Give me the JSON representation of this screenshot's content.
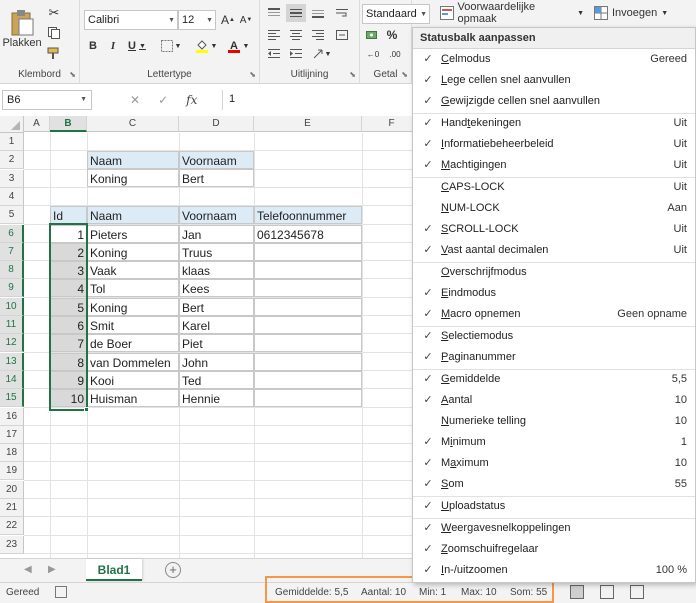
{
  "ribbon": {
    "clipboard": {
      "paste_label": "Plakken",
      "group_label": "Klembord"
    },
    "font": {
      "name": "Calibri",
      "size": "12",
      "bold": "B",
      "italic": "I",
      "underline": "U",
      "grow": "A",
      "shrink": "A",
      "group_label": "Lettertype"
    },
    "alignment": {
      "group_label": "Uitlijning"
    },
    "number": {
      "format": "Standaard",
      "percent": "%",
      "group_label": "Getal"
    },
    "styles": {
      "conditional_label": "Voorwaardelijke opmaak"
    },
    "cells": {
      "insert_label": "Invoegen"
    }
  },
  "formula_bar": {
    "name_box": "B6",
    "fx": "fx",
    "value": "1"
  },
  "columns": [
    "A",
    "B",
    "C",
    "D",
    "E",
    "F"
  ],
  "rows": [
    "1",
    "2",
    "3",
    "4",
    "5",
    "6",
    "7",
    "8",
    "9",
    "10",
    "11",
    "12",
    "13",
    "14",
    "15",
    "16",
    "17",
    "18",
    "19",
    "20",
    "21",
    "22",
    "23"
  ],
  "table1": {
    "headers": [
      "Naam",
      "Voornaam"
    ],
    "rows": [
      [
        "Koning",
        "Bert"
      ]
    ]
  },
  "table2": {
    "headers": [
      "Id",
      "Naam",
      "Voornaam",
      "Telefoonnummer"
    ],
    "rows": [
      [
        "1",
        "Pieters",
        "Jan",
        "0612345678"
      ],
      [
        "2",
        "Koning",
        "Truus",
        ""
      ],
      [
        "3",
        "Vaak",
        "klaas",
        ""
      ],
      [
        "4",
        "Tol",
        "Kees",
        ""
      ],
      [
        "5",
        "Koning",
        "Bert",
        ""
      ],
      [
        "6",
        "Smit",
        "Karel",
        ""
      ],
      [
        "7",
        "de Boer",
        "Piet",
        ""
      ],
      [
        "8",
        "van Dommelen",
        "John",
        ""
      ],
      [
        "9",
        "Kooi",
        "Ted",
        ""
      ],
      [
        "10",
        "Huisman",
        "Hennie",
        ""
      ]
    ]
  },
  "sheet_tabs": {
    "active": "Blad1",
    "add": "+"
  },
  "status_bar": {
    "mode": "Gereed",
    "average": "Gemiddelde: 5,5",
    "count": "Aantal: 10",
    "min": "Min: 1",
    "max": "Max: 10",
    "sum": "Som: 55"
  },
  "context_menu": {
    "title": "Statusbalk aanpassen",
    "items": [
      {
        "ak": "C",
        "rest": "elmodus",
        "value": "Gereed",
        "checked": true
      },
      {
        "ak": "L",
        "rest": "ege cellen snel aanvullen",
        "value": "",
        "checked": true
      },
      {
        "ak": "G",
        "rest": "ewijzigde cellen snel aanvullen",
        "value": "",
        "checked": true
      },
      {
        "pre": "Hand",
        "ak": "t",
        "rest": "ekeningen",
        "value": "Uit",
        "checked": true
      },
      {
        "ak": "I",
        "rest": "nformatiebeheerbeleid",
        "value": "Uit",
        "checked": true
      },
      {
        "ak": "M",
        "rest": "achtigingen",
        "value": "Uit",
        "checked": true
      },
      {
        "ak": "C",
        "rest": "APS-LOCK",
        "value": "Uit",
        "checked": false
      },
      {
        "ak": "N",
        "rest": "UM-LOCK",
        "value": "Aan",
        "checked": false
      },
      {
        "ak": "S",
        "rest": "CROLL-LOCK",
        "value": "Uit",
        "checked": true
      },
      {
        "ak": "V",
        "rest": "ast aantal decimalen",
        "value": "Uit",
        "checked": true
      },
      {
        "ak": "O",
        "rest": "verschrijfmodus",
        "value": "",
        "checked": false
      },
      {
        "ak": "E",
        "rest": "indmodus",
        "value": "",
        "checked": true
      },
      {
        "ak": "M",
        "rest": "acro opnemen",
        "value": "Geen opname",
        "checked": true
      },
      {
        "ak": "S",
        "rest": "electiemodus",
        "value": "",
        "checked": true
      },
      {
        "ak": "P",
        "rest": "aginanummer",
        "value": "",
        "checked": true
      },
      {
        "ak": "G",
        "rest": "emiddelde",
        "value": "5,5",
        "checked": true
      },
      {
        "ak": "A",
        "rest": "antal",
        "value": "10",
        "checked": true
      },
      {
        "ak": "N",
        "rest": "umerieke telling",
        "value": "10",
        "checked": false
      },
      {
        "pre": "M",
        "ak": "i",
        "rest": "nimum",
        "value": "1",
        "checked": true
      },
      {
        "pre": "M",
        "ak": "a",
        "rest": "ximum",
        "value": "10",
        "checked": true
      },
      {
        "ak": "S",
        "rest": "om",
        "value": "55",
        "checked": true
      },
      {
        "ak": "U",
        "rest": "ploadstatus",
        "value": "",
        "checked": true
      },
      {
        "ak": "W",
        "rest": "eergavesnelkoppelingen",
        "value": "",
        "checked": true
      },
      {
        "ak": "Z",
        "rest": "oomschuifregelaar",
        "value": "",
        "checked": true
      },
      {
        "ak": "I",
        "rest": "n-/uitzoomen",
        "value": "100 %",
        "checked": true
      }
    ]
  },
  "colors": {
    "excel_green": "#217346",
    "header_blue": "#ddebf7",
    "highlight_orange": "#f79646"
  }
}
